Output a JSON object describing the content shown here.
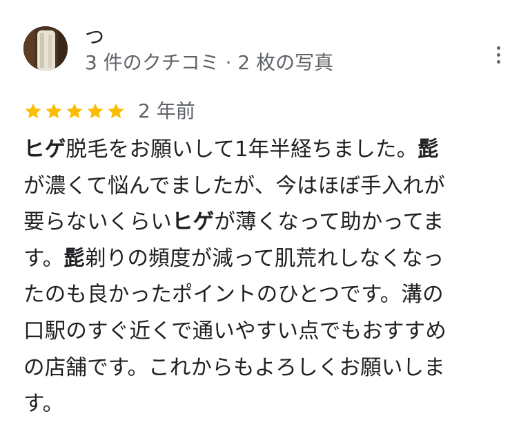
{
  "reviewer": {
    "name": "つ",
    "meta": "3 件のクチコミ · 2 枚の写真"
  },
  "rating": {
    "stars": 5,
    "star_color": "#fbbc04",
    "date": "2 年前"
  },
  "review": {
    "lines": [
      [
        {
          "t": "ヒゲ",
          "b": true
        },
        {
          "t": "脱毛をお願いして1年半経ちました。"
        },
        {
          "t": "髭",
          "b": true
        }
      ],
      [
        {
          "t": "が濃くて悩んでましたが、今はほぼ手入れが"
        }
      ],
      [
        {
          "t": "要らないくらい"
        },
        {
          "t": "ヒゲ",
          "b": true
        },
        {
          "t": "が薄くなって助かってま"
        }
      ],
      [
        {
          "t": "す。"
        },
        {
          "t": "髭",
          "b": true
        },
        {
          "t": "剃りの頻度が減って肌荒れしなくなっ"
        }
      ],
      [
        {
          "t": "たのも良かったポイントのひとつです。溝の"
        }
      ],
      [
        {
          "t": "口駅のすぐ近くで通いやすい点でもおすすめ"
        }
      ],
      [
        {
          "t": "の店舗です。これからもよろしくお願いしま"
        }
      ],
      [
        {
          "t": "す。"
        }
      ]
    ]
  },
  "icons": {
    "menu": "more-vert-icon",
    "star": "star-icon",
    "avatar": "avatar"
  },
  "colors": {
    "text": "#202124",
    "secondary": "#5f6368",
    "star": "#fbbc04"
  }
}
